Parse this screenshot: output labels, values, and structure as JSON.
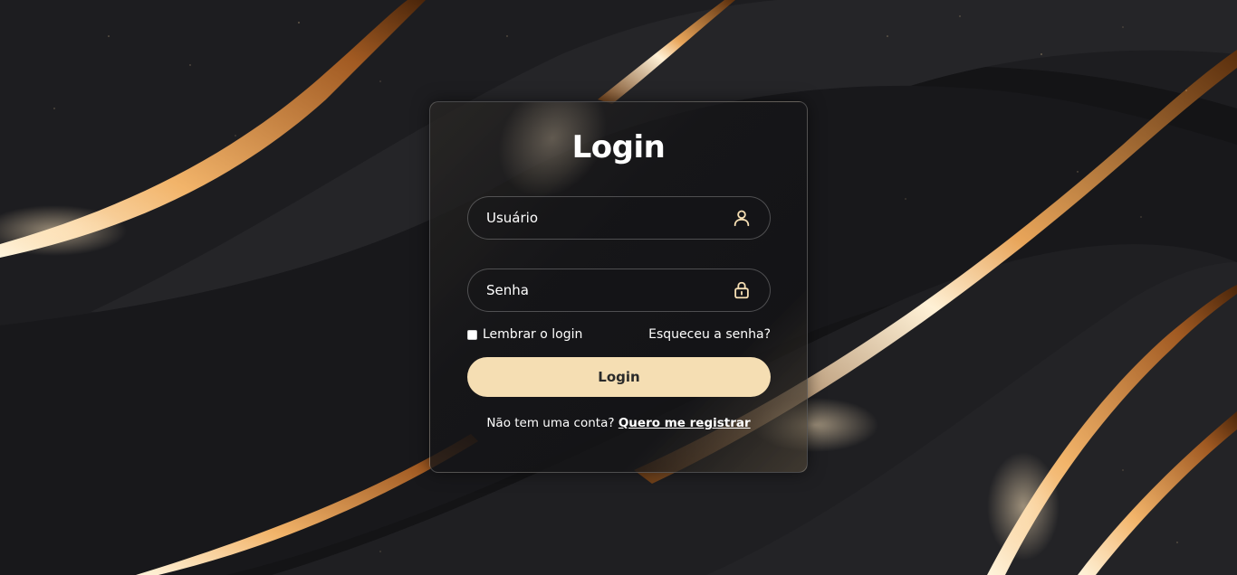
{
  "login": {
    "title": "Login",
    "username_placeholder": "Usuário",
    "password_placeholder": "Senha",
    "remember_label": "Lembrar o login",
    "forgot_label": "Esqueceu a senha?",
    "submit_label": "Login",
    "register_prompt": "Não tem uma conta?",
    "register_link": "Quero me registrar"
  },
  "icons": {
    "username": "user-icon",
    "password": "lock-icon"
  },
  "colors": {
    "accent": "#f5deb3",
    "icon": "#f5deb3",
    "text": "#ffffff",
    "background": "#141416",
    "gold": "#e8a55a"
  }
}
